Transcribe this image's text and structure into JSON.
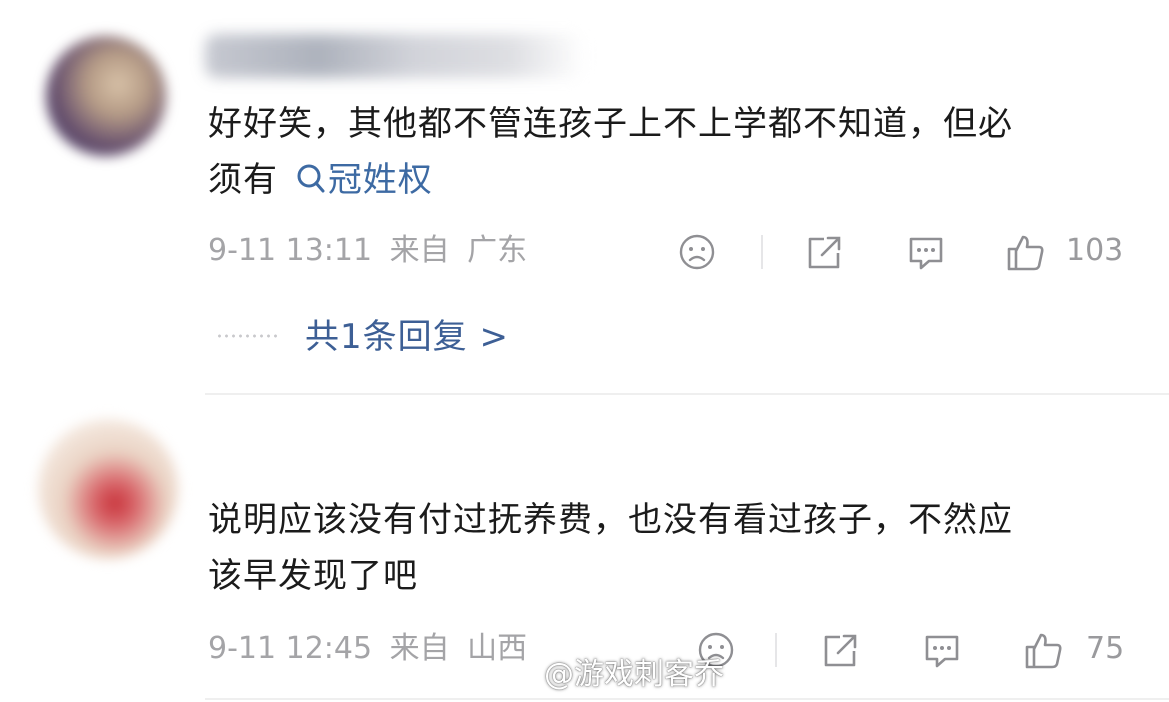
{
  "comments": [
    {
      "text_line1": "好好笑，其他都不管连孩子上不上学都不知道，但必",
      "text_line2_prefix": "须有",
      "topic_label": "冠姓权",
      "timestamp": "9-11 13:11",
      "source_label": "来自",
      "location": "广东",
      "like_count": "103",
      "replies_label": "共1条回复 >"
    },
    {
      "text_line1": "说明应该没有付过抚养费，也没有看过孩子，不然应",
      "text_line2": "该早发现了吧",
      "timestamp": "9-11 12:45",
      "source_label": "来自",
      "location": "山西",
      "like_count": "75"
    }
  ],
  "watermark": {
    "text": "@游戏刺客乔",
    "icon": "weibo-logo-icon"
  },
  "icons": [
    "sad-face-icon",
    "share-icon",
    "comment-icon",
    "like-icon",
    "search-icon"
  ],
  "colors": {
    "topic_link": "#3d6aa3",
    "reply_link": "#3d5f95",
    "meta_gray": "#a4a4a7",
    "text": "#1b1b1b"
  }
}
